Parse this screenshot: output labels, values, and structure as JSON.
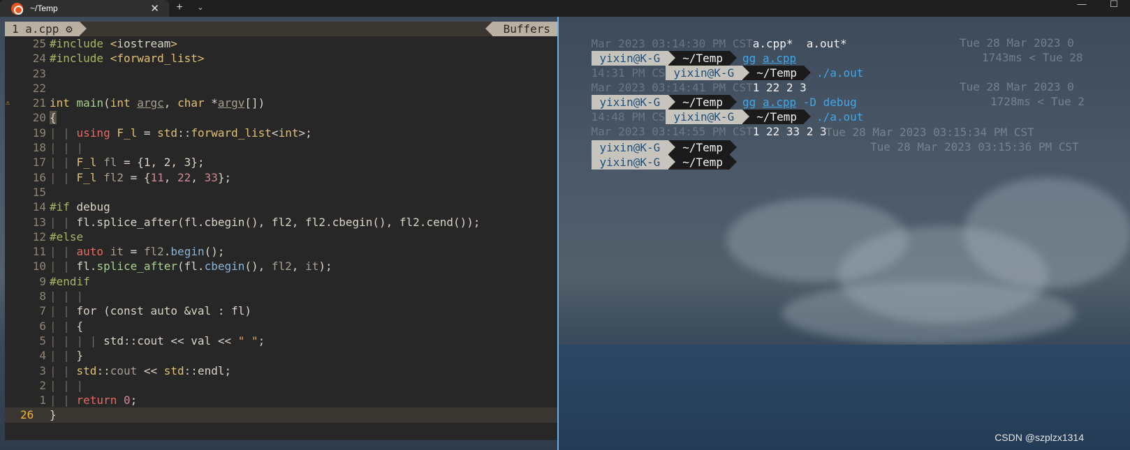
{
  "titlebar": {
    "tab_title": "~/Temp",
    "close": "✕",
    "new_tab": "+",
    "dropdown": "⌄",
    "minimize": "—",
    "maximize": "☐"
  },
  "editor": {
    "buffer_tab": "1 a.cpp ⚙",
    "buffers_label": "Buffers",
    "lines": [
      {
        "num": "25",
        "html": "<span class='inc'>#include</span> <span class='ang'>&lt;</span><span class='op'>iostream</span><span class='ang'>&gt;</span>"
      },
      {
        "num": "24",
        "html": "<span class='inc'>#include</span> <span class='ang'>&lt;forward_list&gt;</span>"
      },
      {
        "num": "23",
        "html": ""
      },
      {
        "num": "22",
        "html": ""
      },
      {
        "num": "21",
        "sign": "⚠",
        "html": "<span class='typ'>int</span> <span class='fn'>main</span>(<span class='typ'>int</span> <span class='dim'><u>argc</u></span>, <span class='typ'>char</span> *<span class='dim'><u>argv</u></span>[])"
      },
      {
        "num": "20",
        "html": "<span class='brace-hl'>{</span>"
      },
      {
        "num": "19",
        "html": "<span class='g'>| | </span><span class='kw'>using</span> <span class='typ'>F_l</span> = <span class='typ'>std</span>::<span class='typ'>forward_list</span>&lt;<span class='typ'>int</span>&gt;;"
      },
      {
        "num": "18",
        "html": "<span class='g'>| | |</span>"
      },
      {
        "num": "17",
        "html": "<span class='g'>| | </span><span class='typ'>F_l</span> <span class='dim'>fl</span> = {1, 2, 3};"
      },
      {
        "num": "16",
        "html": "<span class='g'>| | </span><span class='typ'>F_l</span> <span class='dim'>fl2</span> = {<span class='num'>11</span>, <span class='num'>22</span>, <span class='num'>33</span>};"
      },
      {
        "num": "15",
        "html": ""
      },
      {
        "num": "14",
        "html": "<span class='pre'>#if</span> debug"
      },
      {
        "num": "13",
        "html": "<span class='g'>| | </span>fl.splice_after(fl.cbegin(), fl2, fl2.cbegin(), fl2.cend());"
      },
      {
        "num": "12",
        "html": "<span class='pre'>#else</span>"
      },
      {
        "num": "11",
        "html": "<span class='g'>| | </span><span class='kw'>auto</span> <span class='dim'>it</span> = <span class='dim'>fl2</span>.<span class='mem'>begin</span>();"
      },
      {
        "num": "10",
        "html": "<span class='g'>| | </span>fl.<span class='fn'>splice_after</span>(fl.<span class='mem'>cbegin</span>(), <span class='dim'>fl2</span>, <span class='dim'>it</span>);"
      },
      {
        "num": "9",
        "html": "<span class='pre'>#endif</span>"
      },
      {
        "num": "8",
        "html": "<span class='g'>| | |</span>"
      },
      {
        "num": "7",
        "html": "<span class='g'>| | </span>for (const auto &amp;val : fl)"
      },
      {
        "num": "6",
        "html": "<span class='g'>| | </span>{"
      },
      {
        "num": "5",
        "html": "<span class='g'>| | | | </span>std::cout &lt;&lt; val &lt;&lt; <span class='str'>\" \"</span>;"
      },
      {
        "num": "4",
        "html": "<span class='g'>| | </span>}"
      },
      {
        "num": "3",
        "html": "<span class='g'>| | </span><span class='typ'>std</span>::<span class='dim'>cout</span> &lt;&lt; <span class='typ'>std</span>::endl;"
      },
      {
        "num": "2",
        "html": "<span class='g'>| | |</span>"
      },
      {
        "num": "1",
        "html": "<span class='g'>| | </span><span class='kw'>return</span> <span class='num'>0</span>;"
      },
      {
        "num": "26",
        "cur": true,
        "html": "}"
      }
    ]
  },
  "terminal": {
    "l0_ghost": "Mar 2023 03:14:30 PM CST",
    "l0_text": "a.cpp*  a.out*",
    "user": "yixin@K-G",
    "dir": "~/Temp",
    "cmd1_prefix": "gg ",
    "cmd1_file": "a.cpp",
    "cmd1_time": "Tue 28 Mar 2023 0",
    "l2_ghost": "14:31 PM CS",
    "cmd2": "./a.out",
    "l2_time": "1743ms < Tue 28",
    "l3_ghost": "Mar 2023 03:14:41 PM CST",
    "out1": "1 22 2 3",
    "cmd3_prefix": "gg ",
    "cmd3_file": "a.cpp",
    "cmd3_flag": " -D",
    "cmd3_rest": " debug",
    "cmd3_time": "Tue 28 Mar 2023 0",
    "l5_ghost": "14:48 PM CS",
    "cmd4": "./a.out",
    "l5_time": "1728ms < Tue 2",
    "l6_ghost": "Mar 2023 03:14:55 PM CST",
    "out2": "1 22 33 2 3",
    "time7": "Tue 28 Mar 2023 03:15:34 PM CST",
    "time8": "Tue 28 Mar 2023 03:15:36 PM CST"
  },
  "watermark": "CSDN @szplzx1314"
}
